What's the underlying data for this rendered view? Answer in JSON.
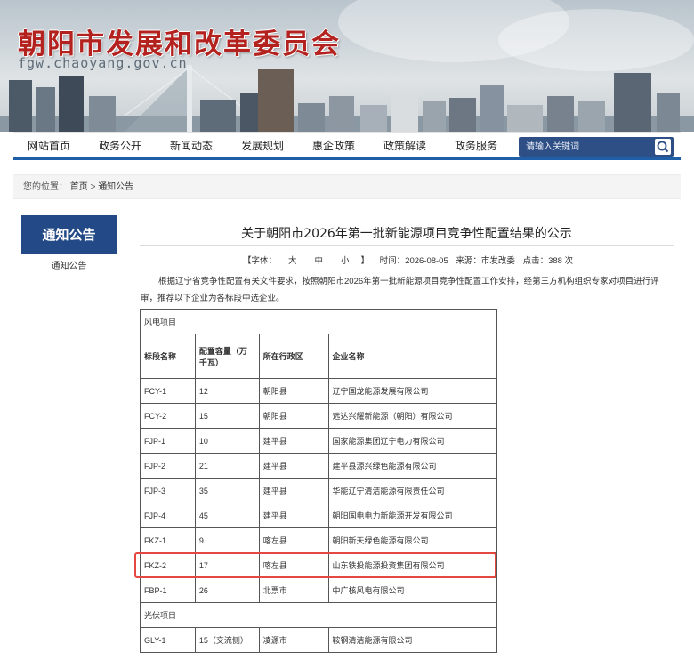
{
  "header": {
    "title": "朝阳市发展和改革委员会",
    "url": "fgw.chaoyang.gov.cn"
  },
  "nav": {
    "items": [
      "网站首页",
      "政务公开",
      "新闻动态",
      "发展规划",
      "惠企政策",
      "政策解读",
      "政务服务"
    ],
    "search_placeholder": "请输入关键词"
  },
  "breadcrumb": {
    "prefix": "您的位置：",
    "home": "首页",
    "separator": ">",
    "current": "通知公告"
  },
  "sidebar": {
    "heading": "通知公告",
    "link": "通知公告"
  },
  "article": {
    "title": "关于朝阳市2026年第一批新能源项目竞争性配置结果的公示",
    "meta": {
      "font_label": "【字体：",
      "size_large": "大",
      "size_medium": "中",
      "size_small": "小",
      "font_close": "】",
      "date": "时间：2026-08-05",
      "source": "来源：市发改委",
      "views": "点击：388 次"
    },
    "paragraph": "根据辽宁省竞争性配置有关文件要求，按照朝阳市2026年第一批新能源项目竞争性配置工作安排，经第三方机构组织专家对项目进行评审，推荐以下企业为各标段中选企业。"
  },
  "table": {
    "section_wind": "风电项目",
    "section_solar": "光伏项目",
    "headers": [
      "标段名称",
      "配置容量（万千瓦）",
      "所在行政区",
      "企业名称"
    ],
    "wind_rows": [
      [
        "FCY-1",
        "12",
        "朝阳县",
        "辽宁国龙能源发展有限公司"
      ],
      [
        "FCY-2",
        "15",
        "朝阳县",
        "远达兴耀新能源（朝阳）有限公司"
      ],
      [
        "FJP-1",
        "10",
        "建平县",
        "国家能源集团辽宁电力有限公司"
      ],
      [
        "FJP-2",
        "21",
        "建平县",
        "建平县源兴绿色能源有限公司"
      ],
      [
        "FJP-3",
        "35",
        "建平县",
        "华能辽宁清洁能源有限责任公司"
      ],
      [
        "FJP-4",
        "45",
        "建平县",
        "朝阳国电电力新能源开发有限公司"
      ],
      [
        "FKZ-1",
        "9",
        "喀左县",
        "朝阳新天绿色能源有限公司"
      ],
      [
        "FKZ-2",
        "17",
        "喀左县",
        "山东铁投能源投资集团有限公司"
      ],
      [
        "FBP-1",
        "26",
        "北票市",
        "中广核风电有限公司"
      ]
    ],
    "solar_rows": [
      [
        "GLY-1",
        "15（交流侧）",
        "凌源市",
        "鞍钢清洁能源有限公司"
      ]
    ]
  },
  "colors": {
    "brand_red": "#b3221e",
    "nav_blue": "#1f5fa8",
    "side_blue": "#234a86",
    "highlight_red": "#e5483f"
  }
}
